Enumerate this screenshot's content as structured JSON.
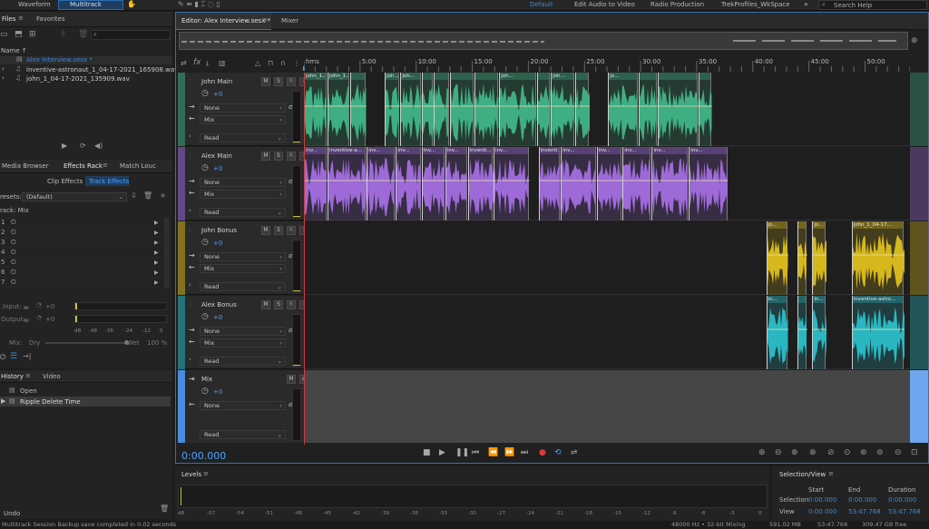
{
  "topbar": {
    "waveform": "Waveform",
    "multitrack": "Multitrack",
    "workspaces": [
      "Default",
      "Edit Audio to Video",
      "Radio Production",
      "TrekProfiles_WkSpace"
    ],
    "more": "»",
    "search_placeholder": "Search Help"
  },
  "files_panel": {
    "tabs": [
      "Files",
      "Favorites"
    ],
    "column_name": "Name ↑",
    "items": [
      {
        "name": "Alex Interview.sesx *"
      },
      {
        "name": "inventive-astronaut_1_04-17-2021_165908.wav"
      },
      {
        "name": "john_1_04-17-2021_135909.wav"
      }
    ]
  },
  "effects_panel": {
    "tabs": [
      "Media Browser",
      "Effects Rack",
      "Match Louc"
    ],
    "subtabs": [
      "Clip Effects",
      "Track Effects"
    ],
    "presets_label": "resets:",
    "presets_value": "(Default)",
    "track_label": "rack: Mix",
    "slots": [
      "1",
      "2",
      "3",
      "4",
      "5",
      "6",
      "7"
    ],
    "input_label": "Input:",
    "input_value": "+0",
    "output_label": "Output:",
    "output_value": "+0",
    "meter_ticks": [
      "dB",
      "-48",
      "-36",
      "-24",
      "-12",
      "0"
    ],
    "mix_label": "Mix:",
    "dry": "Dry",
    "wet": "Wet",
    "mix_value": "100 %"
  },
  "history_panel": {
    "tabs": [
      "History",
      "Video"
    ],
    "items": [
      "Open",
      "Ripple Delete Time"
    ]
  },
  "editor": {
    "tabs": [
      "Editor: Alex Interview.sesx *",
      "Mixer"
    ],
    "ruler": [
      "hms",
      "5:00",
      "10:00",
      "15:00",
      "20:00",
      "25:00",
      "30:00",
      "35:00",
      "40:00",
      "45:00",
      "50:00"
    ],
    "timecode": "0:00.000"
  },
  "tracks": [
    {
      "name": "John Main",
      "vol": "+0",
      "input": "None",
      "output": "Mix",
      "mode": "Read",
      "color": "#3fae83",
      "clips": [
        {
          "start": 0.0,
          "end": 2.1,
          "label": "john_1..."
        },
        {
          "start": 2.1,
          "end": 4.1,
          "label": "john_1..."
        },
        {
          "start": 4.1,
          "end": 5.6,
          "label": ""
        },
        {
          "start": 7.2,
          "end": 8.6,
          "label": "joh..."
        },
        {
          "start": 8.6,
          "end": 10.5,
          "label": "joh..."
        },
        {
          "start": 10.5,
          "end": 11.6,
          "label": ""
        },
        {
          "start": 11.6,
          "end": 13.0,
          "label": ""
        },
        {
          "start": 13.0,
          "end": 15.2,
          "label": ""
        },
        {
          "start": 15.2,
          "end": 17.4,
          "label": ""
        },
        {
          "start": 17.4,
          "end": 20.8,
          "label": "joh..."
        },
        {
          "start": 20.8,
          "end": 22.0,
          "label": ""
        },
        {
          "start": 22.0,
          "end": 24.2,
          "label": "joh..."
        },
        {
          "start": 24.2,
          "end": 25.5,
          "label": ""
        },
        {
          "start": 27.1,
          "end": 29.8,
          "label": "jo..."
        },
        {
          "start": 29.8,
          "end": 31.5,
          "label": ""
        },
        {
          "start": 31.5,
          "end": 35.2,
          "label": ""
        },
        {
          "start": 35.2,
          "end": 36.4,
          "label": ""
        }
      ]
    },
    {
      "name": "Alex Main",
      "vol": "+0",
      "input": "None",
      "output": "Mix",
      "mode": "Read",
      "color": "#9d6ad8",
      "clips": [
        {
          "start": 0.0,
          "end": 2.1,
          "label": "inv..."
        },
        {
          "start": 2.1,
          "end": 5.6,
          "label": "inventive-a..."
        },
        {
          "start": 5.6,
          "end": 8.2,
          "label": "inv..."
        },
        {
          "start": 8.2,
          "end": 10.5,
          "label": "inv..."
        },
        {
          "start": 10.5,
          "end": 12.6,
          "label": "inv..."
        },
        {
          "start": 12.6,
          "end": 14.6,
          "label": "inv..."
        },
        {
          "start": 14.6,
          "end": 16.9,
          "label": "inventi..."
        },
        {
          "start": 16.9,
          "end": 20.1,
          "label": "inv..."
        },
        {
          "start": 20.9,
          "end": 22.9,
          "label": "inventi..."
        },
        {
          "start": 22.9,
          "end": 26.1,
          "label": "inv..."
        },
        {
          "start": 26.1,
          "end": 28.4,
          "label": "inv..."
        },
        {
          "start": 28.4,
          "end": 31.0,
          "label": "inv..."
        },
        {
          "start": 31.0,
          "end": 34.3,
          "label": "inv..."
        },
        {
          "start": 34.3,
          "end": 37.8,
          "label": "inv..."
        }
      ]
    },
    {
      "name": "John Bonus",
      "vol": "+0",
      "input": "None",
      "output": "Mix",
      "mode": "Read",
      "color": "#d6b81d",
      "clips": [
        {
          "start": 41.2,
          "end": 43.2,
          "label": "jo..."
        },
        {
          "start": 44.0,
          "end": 44.9,
          "label": ""
        },
        {
          "start": 45.3,
          "end": 46.6,
          "label": "jo..."
        },
        {
          "start": 48.8,
          "end": 53.5,
          "label": "john_1_04-17..."
        }
      ]
    },
    {
      "name": "Alex Bonus",
      "vol": "+0",
      "input": "None",
      "output": "Mix",
      "mode": "Read",
      "color": "#2ab7c2",
      "clips": [
        {
          "start": 41.2,
          "end": 43.2,
          "label": "in..."
        },
        {
          "start": 44.0,
          "end": 44.9,
          "label": ""
        },
        {
          "start": 45.3,
          "end": 46.6,
          "label": "in..."
        },
        {
          "start": 48.8,
          "end": 53.5,
          "label": "inventive-astro..."
        }
      ]
    }
  ],
  "mix_track": {
    "name": "Mix",
    "vol": "+0",
    "output": "None",
    "mode": "Read"
  },
  "levels": {
    "title": "Levels",
    "ticks": [
      "dB",
      "-57",
      "-54",
      "-51",
      "-48",
      "-45",
      "-42",
      "-39",
      "-36",
      "-33",
      "-30",
      "-27",
      "-24",
      "-21",
      "-18",
      "-15",
      "-12",
      "-9",
      "-6",
      "-3",
      "0"
    ]
  },
  "selection_view": {
    "title": "Selection/View",
    "headers": [
      "Start",
      "End",
      "Duration"
    ],
    "rows": [
      {
        "label": "Selection",
        "start": "0:00.000",
        "end": "0:00.000",
        "duration": "0:00.000"
      },
      {
        "label": "View",
        "start": "0:00.000",
        "end": "53:47.768",
        "duration": "53:47.768"
      }
    ]
  },
  "statusbar": {
    "message": "Multitrack Session Backup save completed in 0.02 seconds",
    "undo": "Undo",
    "format": "48000 Hz • 32-bit Mixing",
    "memory": "591.02 MB",
    "duration": "53:47.768",
    "free": "309.47 GB free"
  },
  "colors": {
    "accent": "#2d8ceb",
    "record": "#e03a3a"
  }
}
